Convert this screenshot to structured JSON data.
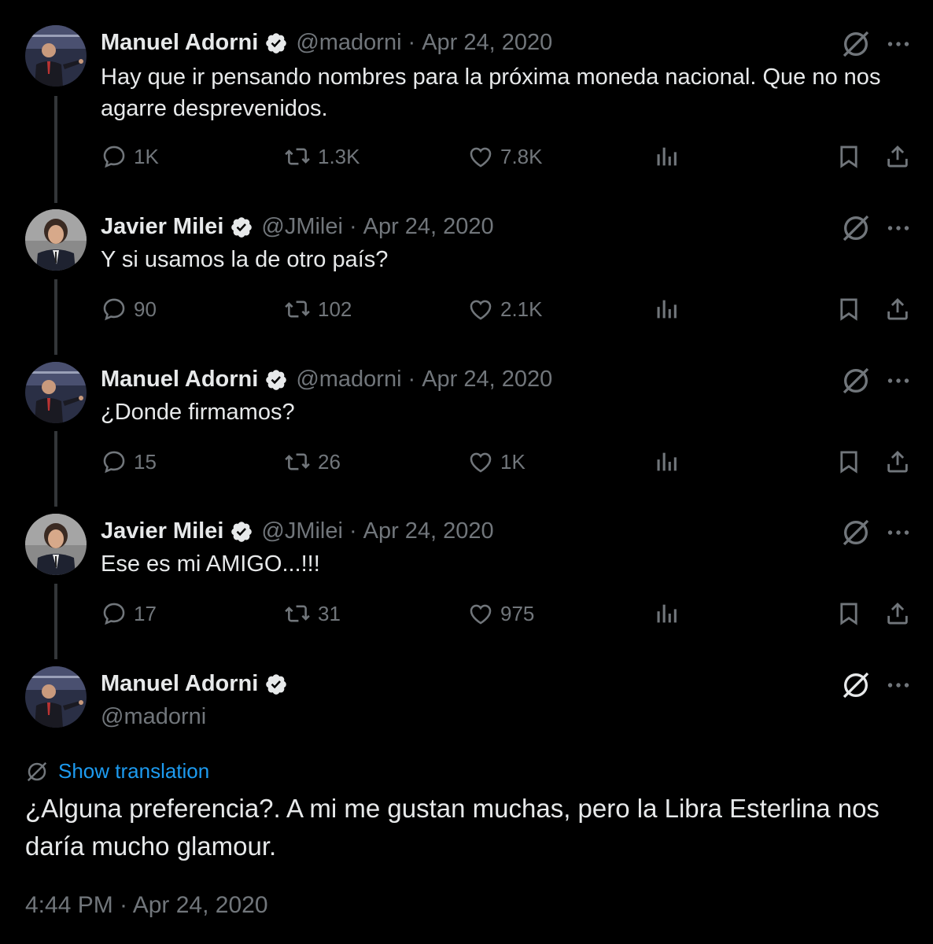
{
  "colors": {
    "background": "#000000",
    "text": "#e7e9ea",
    "secondary": "#71767b",
    "link": "#1d9bf0",
    "verified": "#e7e9ea"
  },
  "tweets": [
    {
      "name": "Manuel Adorni",
      "handle": "@madorni",
      "sep": "·",
      "date": "Apr 24, 2020",
      "text": "Hay que ir pensando nombres para la próxima moneda nacional. Que no nos agarre desprevenidos.",
      "replies": "1K",
      "retweets": "1.3K",
      "likes": "7.8K",
      "avatar_icon": "avatar-adorni-icon"
    },
    {
      "name": "Javier Milei",
      "handle": "@JMilei",
      "sep": "·",
      "date": "Apr 24, 2020",
      "text": "Y si usamos la de otro país?",
      "replies": "90",
      "retweets": "102",
      "likes": "2.1K",
      "avatar_icon": "avatar-milei-icon"
    },
    {
      "name": "Manuel Adorni",
      "handle": "@madorni",
      "sep": "·",
      "date": "Apr 24, 2020",
      "text": "¿Donde firmamos?",
      "replies": "15",
      "retweets": "26",
      "likes": "1K",
      "avatar_icon": "avatar-adorni-icon"
    },
    {
      "name": "Javier Milei",
      "handle": "@JMilei",
      "sep": "·",
      "date": "Apr 24, 2020",
      "text": "Ese es mi AMIGO...!!!",
      "replies": "17",
      "retweets": "31",
      "likes": "975",
      "avatar_icon": "avatar-milei-icon"
    }
  ],
  "main": {
    "name": "Manuel Adorni",
    "handle": "@madorni",
    "show_translation": "Show translation",
    "text": "¿Alguna preferencia?. A mi me gustan muchas, pero la Libra Esterlina nos daría mucho glamour.",
    "timestamp": "4:44 PM · Apr 24, 2020"
  }
}
